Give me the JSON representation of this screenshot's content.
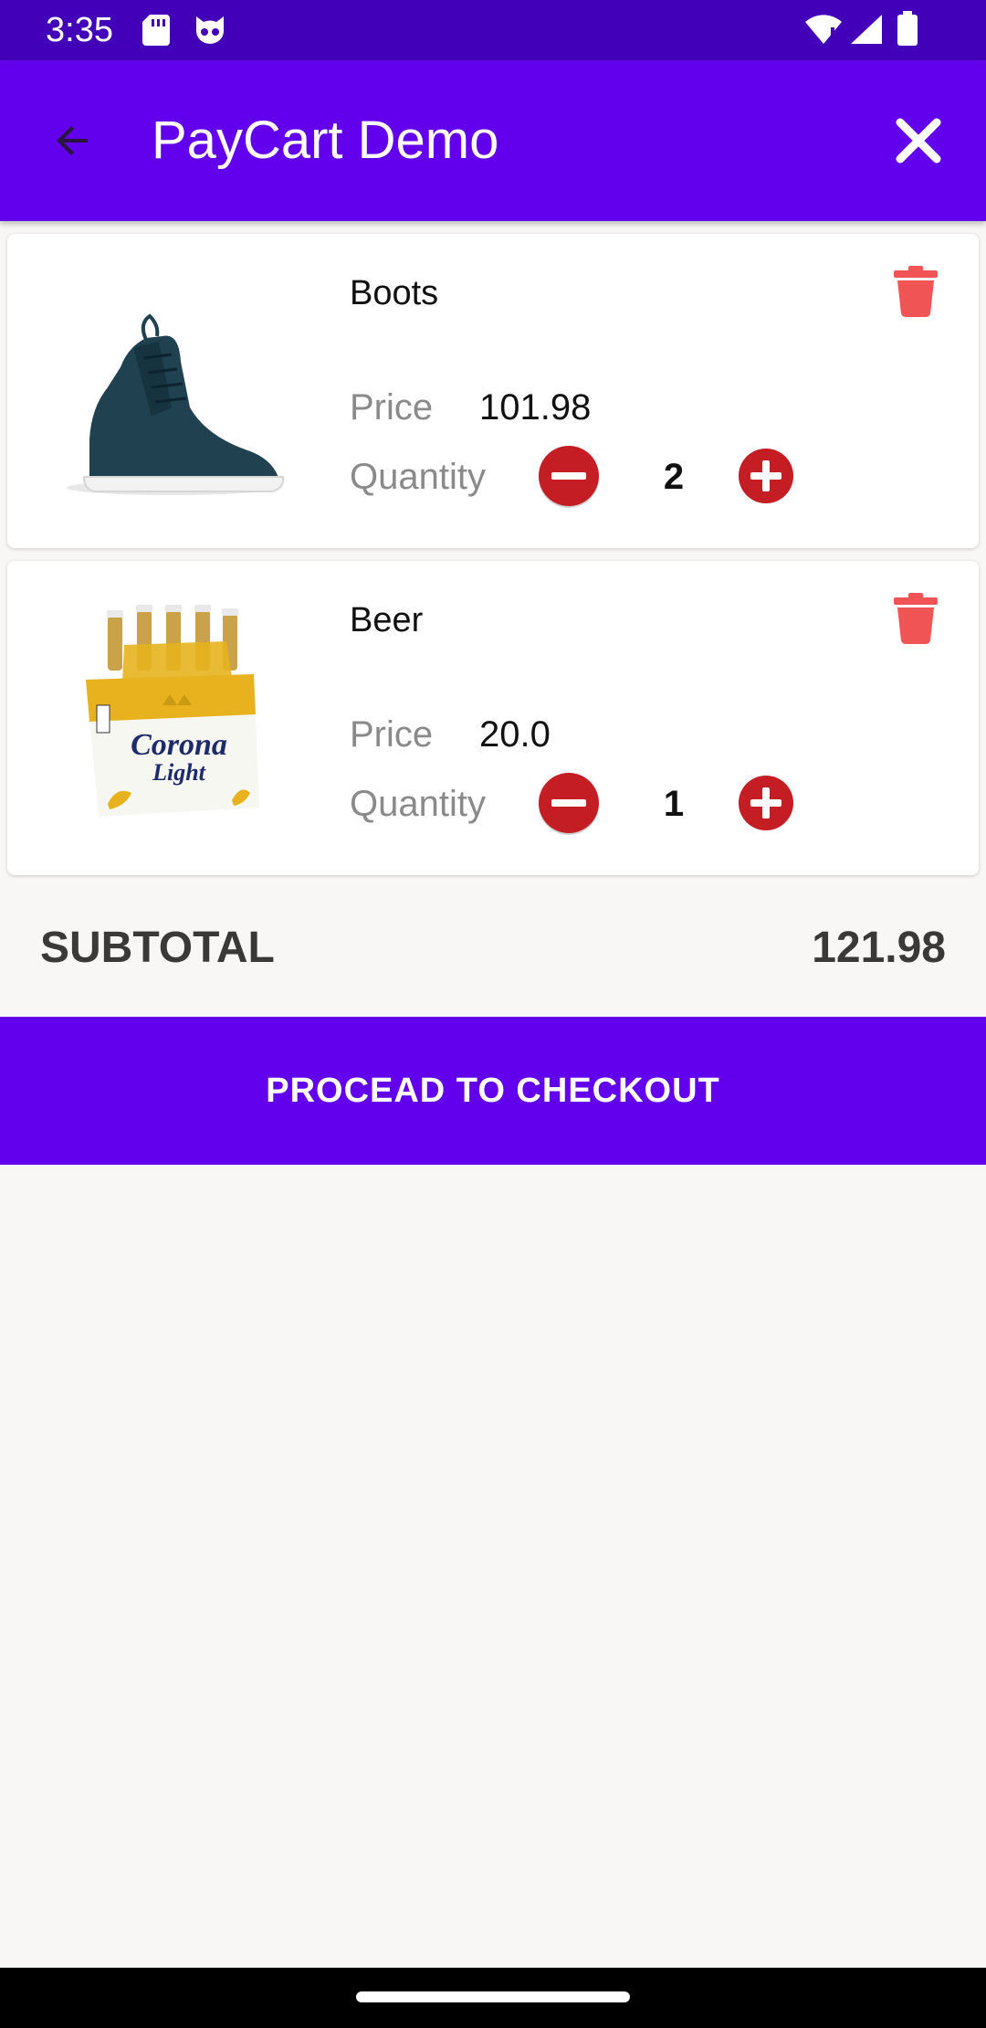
{
  "status_bar": {
    "time": "3:35",
    "icons": [
      "sd-card-icon",
      "cat-icon",
      "wifi-icon",
      "signal-icon",
      "battery-icon"
    ]
  },
  "app_bar": {
    "title": "PayCart Demo",
    "back_icon": "arrow-back-icon",
    "close_icon": "close-icon",
    "background": "#6200ee"
  },
  "cart": {
    "price_label": "Price",
    "quantity_label": "Quantity",
    "items": [
      {
        "name": "Boots",
        "price": "101.98",
        "quantity": "2",
        "image": "sneaker-image"
      },
      {
        "name": "Beer",
        "price": "20.0",
        "quantity": "1",
        "image": "corona-light-six-pack-image"
      }
    ]
  },
  "summary": {
    "subtotal_label": "SUBTOTAL",
    "subtotal_value": "121.98"
  },
  "checkout": {
    "label": "PROCEAD TO CHECKOUT"
  },
  "colors": {
    "primary": "#6200ee",
    "status_bar": "#4200b8",
    "delete": "#f05454",
    "stepper": "#c41e24"
  }
}
